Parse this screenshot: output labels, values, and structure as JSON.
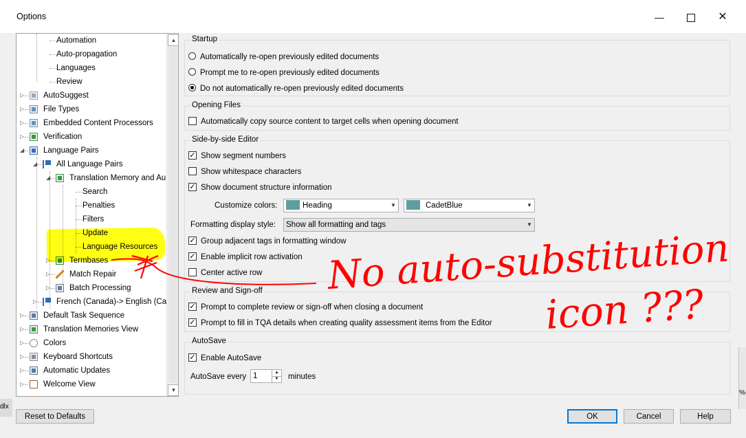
{
  "window": {
    "title": "Options"
  },
  "tree": {
    "items": [
      {
        "label": "Automation",
        "level": 2,
        "icon": "none"
      },
      {
        "label": "Auto-propagation",
        "level": 2,
        "icon": "none"
      },
      {
        "label": "Languages",
        "level": 2,
        "icon": "none"
      },
      {
        "label": "Review",
        "level": 2,
        "icon": "none"
      },
      {
        "label": "AutoSuggest",
        "level": 1,
        "icon": "autosuggest-icon",
        "expand": "collapsed"
      },
      {
        "label": "File Types",
        "level": 1,
        "icon": "file-types-icon",
        "expand": "collapsed"
      },
      {
        "label": "Embedded Content Processors",
        "level": 1,
        "icon": "embedded-content-icon",
        "expand": "collapsed"
      },
      {
        "label": "Verification",
        "level": 1,
        "icon": "verification-icon",
        "expand": "collapsed"
      },
      {
        "label": "Language Pairs",
        "level": 1,
        "icon": "language-pairs-icon",
        "expand": "expanded"
      },
      {
        "label": "All Language Pairs",
        "level": 2,
        "icon": "flag-icon",
        "expand": "expanded"
      },
      {
        "label": "Translation Memory and Au",
        "level": 3,
        "icon": "translation-memory-icon",
        "expand": "expanded"
      },
      {
        "label": "Search",
        "level": 4,
        "icon": "none"
      },
      {
        "label": "Penalties",
        "level": 4,
        "icon": "none"
      },
      {
        "label": "Filters",
        "level": 4,
        "icon": "none"
      },
      {
        "label": "Update",
        "level": 4,
        "icon": "none"
      },
      {
        "label": "Language Resources",
        "level": 4,
        "icon": "none"
      },
      {
        "label": "Termbases",
        "level": 3,
        "icon": "termbase-icon",
        "expand": "collapsed"
      },
      {
        "label": "Match Repair",
        "level": 3,
        "icon": "wrench-icon",
        "expand": "collapsed"
      },
      {
        "label": "Batch Processing",
        "level": 3,
        "icon": "batch-processing-icon",
        "expand": "collapsed"
      },
      {
        "label": "French (Canada)-> English (Can",
        "level": 2,
        "icon": "flag-icon",
        "expand": "collapsed"
      },
      {
        "label": "Default Task Sequence",
        "level": 1,
        "icon": "task-sequence-icon",
        "expand": "collapsed"
      },
      {
        "label": "Translation Memories View",
        "level": 1,
        "icon": "translation-memory-icon",
        "expand": "collapsed"
      },
      {
        "label": "Colors",
        "level": 1,
        "icon": "colors-icon",
        "expand": "collapsed"
      },
      {
        "label": "Keyboard Shortcuts",
        "level": 1,
        "icon": "keyboard-icon",
        "expand": "collapsed"
      },
      {
        "label": "Automatic Updates",
        "level": 1,
        "icon": "automatic-updates-icon",
        "expand": "collapsed"
      },
      {
        "label": "Welcome View",
        "level": 1,
        "icon": "home-icon",
        "expand": "collapsed"
      }
    ]
  },
  "startup": {
    "title": "Startup",
    "options": [
      {
        "label": "Automatically re-open previously edited documents",
        "selected": false
      },
      {
        "label": "Prompt me to re-open previously edited documents",
        "selected": false
      },
      {
        "label": "Do not automatically re-open previously edited documents",
        "selected": true
      }
    ]
  },
  "opening_files": {
    "title": "Opening Files",
    "copy_source": {
      "label": "Automatically copy source content to target cells when opening document",
      "checked": false
    }
  },
  "editor": {
    "title": "Side-by-side Editor",
    "show_segment_numbers": {
      "label": "Show segment numbers",
      "checked": true
    },
    "show_whitespace": {
      "label": "Show whitespace characters",
      "checked": false
    },
    "show_structure": {
      "label": "Show document structure information",
      "checked": true
    },
    "customize_colors_label": "Customize colors:",
    "color_element": "Heading",
    "color_value": "CadetBlue",
    "color_swatch": "#5f9ea0",
    "formatting_label": "Formatting display style:",
    "formatting_value": "Show all formatting and tags",
    "group_tags": {
      "label": "Group adjacent tags in formatting window",
      "checked": true
    },
    "implicit_row": {
      "label": "Enable implicit row activation",
      "checked": true
    },
    "center_row": {
      "label": "Center active row",
      "checked": false
    }
  },
  "review": {
    "title": "Review and Sign-off",
    "prompt_review": {
      "label": "Prompt to complete review or sign-off when closing a document",
      "checked": true
    },
    "prompt_tqa": {
      "label": "Prompt to fill in TQA details when creating quality assessment items from the Editor",
      "checked": true
    }
  },
  "autosave": {
    "title": "AutoSave",
    "enable": {
      "label": "Enable AutoSave",
      "checked": true
    },
    "every_label": "AutoSave every",
    "every_value": "1",
    "unit_label": "minutes"
  },
  "buttons": {
    "reset": "Reset to Defaults",
    "ok": "OK",
    "cancel": "Cancel",
    "help": "Help"
  },
  "background_fragments": {
    "left_edge": "dlx",
    "right_edge": "%-"
  },
  "highlight_color": "#ffff00",
  "annotation": {
    "color": "#ff0000",
    "line1": "No auto-substitution",
    "line2": "icon ???"
  }
}
